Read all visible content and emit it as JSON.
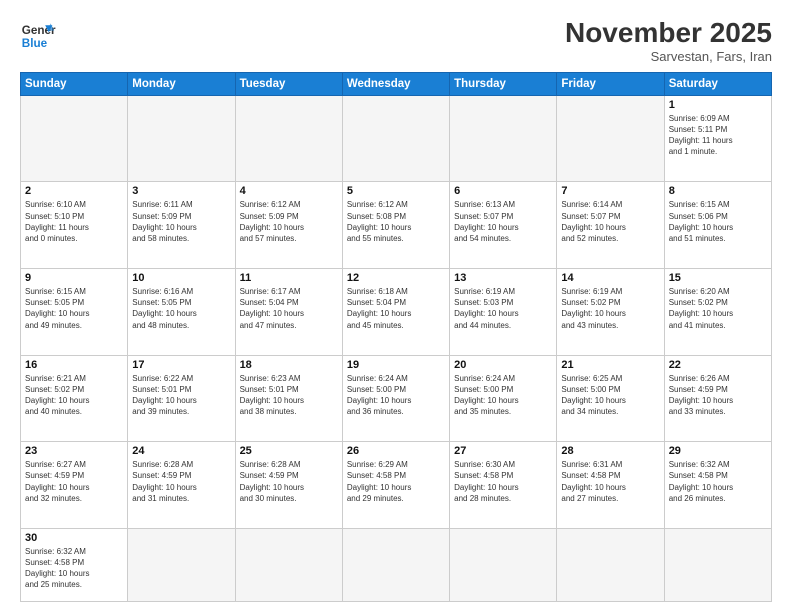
{
  "header": {
    "logo_general": "General",
    "logo_blue": "Blue",
    "month_title": "November 2025",
    "subtitle": "Sarvestan, Fars, Iran"
  },
  "days_of_week": [
    "Sunday",
    "Monday",
    "Tuesday",
    "Wednesday",
    "Thursday",
    "Friday",
    "Saturday"
  ],
  "weeks": [
    [
      {
        "day": "",
        "info": "",
        "empty": true
      },
      {
        "day": "",
        "info": "",
        "empty": true
      },
      {
        "day": "",
        "info": "",
        "empty": true
      },
      {
        "day": "",
        "info": "",
        "empty": true
      },
      {
        "day": "",
        "info": "",
        "empty": true
      },
      {
        "day": "",
        "info": "",
        "empty": true
      },
      {
        "day": "1",
        "info": "Sunrise: 6:09 AM\nSunset: 5:11 PM\nDaylight: 11 hours\nand 1 minute."
      }
    ],
    [
      {
        "day": "2",
        "info": "Sunrise: 6:10 AM\nSunset: 5:10 PM\nDaylight: 11 hours\nand 0 minutes."
      },
      {
        "day": "3",
        "info": "Sunrise: 6:11 AM\nSunset: 5:09 PM\nDaylight: 10 hours\nand 58 minutes."
      },
      {
        "day": "4",
        "info": "Sunrise: 6:12 AM\nSunset: 5:09 PM\nDaylight: 10 hours\nand 57 minutes."
      },
      {
        "day": "5",
        "info": "Sunrise: 6:12 AM\nSunset: 5:08 PM\nDaylight: 10 hours\nand 55 minutes."
      },
      {
        "day": "6",
        "info": "Sunrise: 6:13 AM\nSunset: 5:07 PM\nDaylight: 10 hours\nand 54 minutes."
      },
      {
        "day": "7",
        "info": "Sunrise: 6:14 AM\nSunset: 5:07 PM\nDaylight: 10 hours\nand 52 minutes."
      },
      {
        "day": "8",
        "info": "Sunrise: 6:15 AM\nSunset: 5:06 PM\nDaylight: 10 hours\nand 51 minutes."
      }
    ],
    [
      {
        "day": "9",
        "info": "Sunrise: 6:15 AM\nSunset: 5:05 PM\nDaylight: 10 hours\nand 49 minutes."
      },
      {
        "day": "10",
        "info": "Sunrise: 6:16 AM\nSunset: 5:05 PM\nDaylight: 10 hours\nand 48 minutes."
      },
      {
        "day": "11",
        "info": "Sunrise: 6:17 AM\nSunset: 5:04 PM\nDaylight: 10 hours\nand 47 minutes."
      },
      {
        "day": "12",
        "info": "Sunrise: 6:18 AM\nSunset: 5:04 PM\nDaylight: 10 hours\nand 45 minutes."
      },
      {
        "day": "13",
        "info": "Sunrise: 6:19 AM\nSunset: 5:03 PM\nDaylight: 10 hours\nand 44 minutes."
      },
      {
        "day": "14",
        "info": "Sunrise: 6:19 AM\nSunset: 5:02 PM\nDaylight: 10 hours\nand 43 minutes."
      },
      {
        "day": "15",
        "info": "Sunrise: 6:20 AM\nSunset: 5:02 PM\nDaylight: 10 hours\nand 41 minutes."
      }
    ],
    [
      {
        "day": "16",
        "info": "Sunrise: 6:21 AM\nSunset: 5:02 PM\nDaylight: 10 hours\nand 40 minutes."
      },
      {
        "day": "17",
        "info": "Sunrise: 6:22 AM\nSunset: 5:01 PM\nDaylight: 10 hours\nand 39 minutes."
      },
      {
        "day": "18",
        "info": "Sunrise: 6:23 AM\nSunset: 5:01 PM\nDaylight: 10 hours\nand 38 minutes."
      },
      {
        "day": "19",
        "info": "Sunrise: 6:24 AM\nSunset: 5:00 PM\nDaylight: 10 hours\nand 36 minutes."
      },
      {
        "day": "20",
        "info": "Sunrise: 6:24 AM\nSunset: 5:00 PM\nDaylight: 10 hours\nand 35 minutes."
      },
      {
        "day": "21",
        "info": "Sunrise: 6:25 AM\nSunset: 5:00 PM\nDaylight: 10 hours\nand 34 minutes."
      },
      {
        "day": "22",
        "info": "Sunrise: 6:26 AM\nSunset: 4:59 PM\nDaylight: 10 hours\nand 33 minutes."
      }
    ],
    [
      {
        "day": "23",
        "info": "Sunrise: 6:27 AM\nSunset: 4:59 PM\nDaylight: 10 hours\nand 32 minutes."
      },
      {
        "day": "24",
        "info": "Sunrise: 6:28 AM\nSunset: 4:59 PM\nDaylight: 10 hours\nand 31 minutes."
      },
      {
        "day": "25",
        "info": "Sunrise: 6:28 AM\nSunset: 4:59 PM\nDaylight: 10 hours\nand 30 minutes."
      },
      {
        "day": "26",
        "info": "Sunrise: 6:29 AM\nSunset: 4:58 PM\nDaylight: 10 hours\nand 29 minutes."
      },
      {
        "day": "27",
        "info": "Sunrise: 6:30 AM\nSunset: 4:58 PM\nDaylight: 10 hours\nand 28 minutes."
      },
      {
        "day": "28",
        "info": "Sunrise: 6:31 AM\nSunset: 4:58 PM\nDaylight: 10 hours\nand 27 minutes."
      },
      {
        "day": "29",
        "info": "Sunrise: 6:32 AM\nSunset: 4:58 PM\nDaylight: 10 hours\nand 26 minutes."
      }
    ],
    [
      {
        "day": "30",
        "info": "Sunrise: 6:32 AM\nSunset: 4:58 PM\nDaylight: 10 hours\nand 25 minutes."
      },
      {
        "day": "",
        "info": "",
        "empty": true
      },
      {
        "day": "",
        "info": "",
        "empty": true
      },
      {
        "day": "",
        "info": "",
        "empty": true
      },
      {
        "day": "",
        "info": "",
        "empty": true
      },
      {
        "day": "",
        "info": "",
        "empty": true
      },
      {
        "day": "",
        "info": "",
        "empty": true
      }
    ]
  ]
}
